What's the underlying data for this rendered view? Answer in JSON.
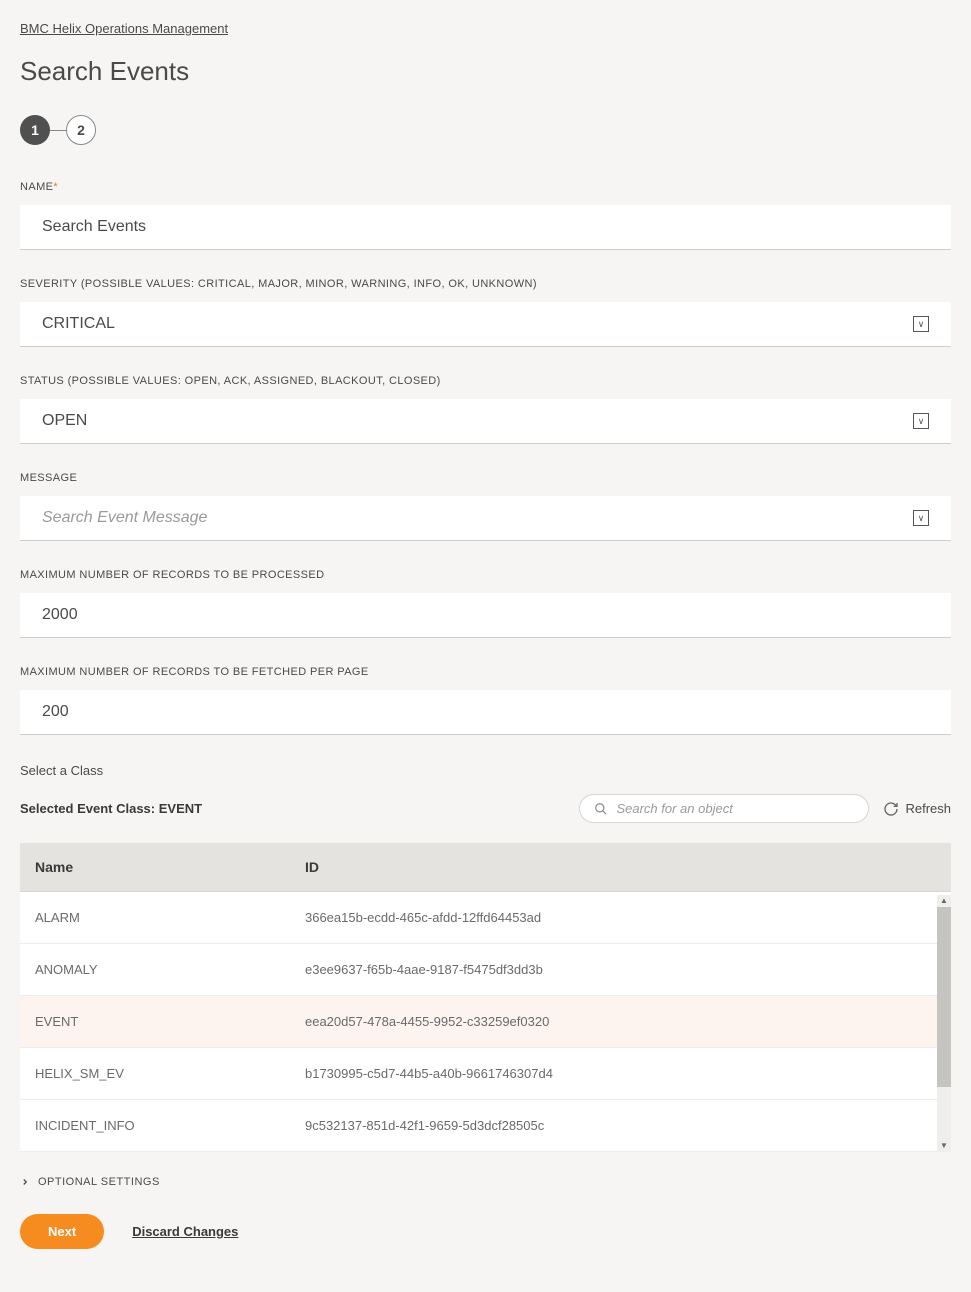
{
  "breadcrumb": "BMC Helix Operations Management",
  "title": "Search Events",
  "stepper": {
    "step1": "1",
    "step2": "2"
  },
  "fields": {
    "name": {
      "label": "NAME",
      "value": "Search Events"
    },
    "severity": {
      "label": "SEVERITY (POSSIBLE VALUES: CRITICAL, MAJOR, MINOR, WARNING, INFO, OK, UNKNOWN)",
      "value": "CRITICAL"
    },
    "status": {
      "label": "STATUS (POSSIBLE VALUES: OPEN, ACK, ASSIGNED, BLACKOUT, CLOSED)",
      "value": "OPEN"
    },
    "message": {
      "label": "MESSAGE",
      "placeholder": "Search Event Message"
    },
    "maxProcessed": {
      "label": "MAXIMUM NUMBER OF RECORDS TO BE PROCESSED",
      "value": "2000"
    },
    "maxPerPage": {
      "label": "MAXIMUM NUMBER OF RECORDS TO BE FETCHED PER PAGE",
      "value": "200"
    }
  },
  "classPicker": {
    "selectLabel": "Select a Class",
    "selectedLabel": "Selected Event Class: EVENT",
    "searchPlaceholder": "Search for an object",
    "refreshLabel": "Refresh",
    "columns": {
      "name": "Name",
      "id": "ID"
    },
    "rows": [
      {
        "name": "ALARM",
        "id": "366ea15b-ecdd-465c-afdd-12ffd64453ad",
        "selected": false
      },
      {
        "name": "ANOMALY",
        "id": "e3ee9637-f65b-4aae-9187-f5475df3dd3b",
        "selected": false
      },
      {
        "name": "EVENT",
        "id": "eea20d57-478a-4455-9952-c33259ef0320",
        "selected": true
      },
      {
        "name": "HELIX_SM_EV",
        "id": "b1730995-c5d7-44b5-a40b-9661746307d4",
        "selected": false
      },
      {
        "name": "INCIDENT_INFO",
        "id": "9c532137-851d-42f1-9659-5d3dcf28505c",
        "selected": false
      }
    ]
  },
  "optional": "OPTIONAL SETTINGS",
  "buttons": {
    "next": "Next",
    "discard": "Discard Changes"
  }
}
